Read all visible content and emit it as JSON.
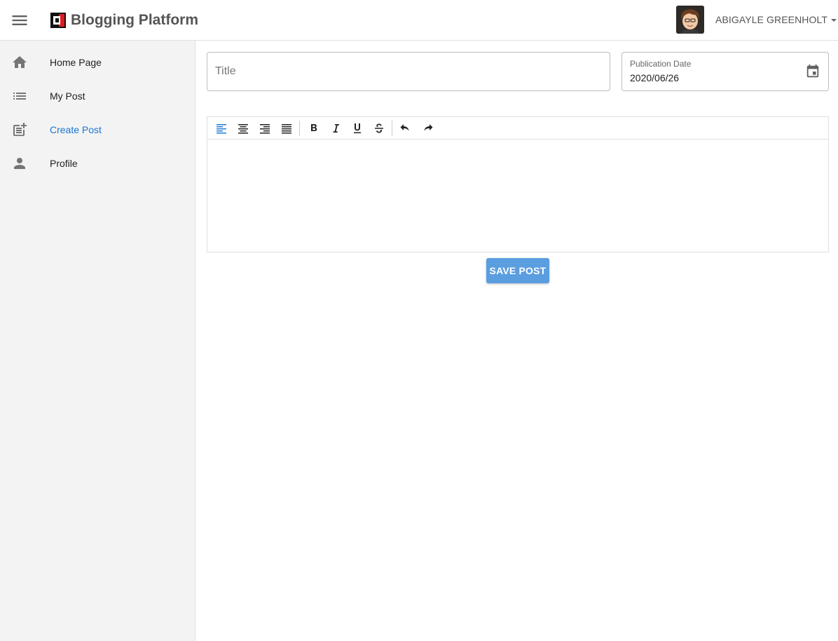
{
  "header": {
    "app_title": "Blogging Platform",
    "user_name": "ABIGAYLE GREENHOLT"
  },
  "sidebar": {
    "items": [
      {
        "label": "Home Page",
        "icon": "home-icon",
        "active": false
      },
      {
        "label": "My Post",
        "icon": "list-icon",
        "active": false
      },
      {
        "label": "Create Post",
        "icon": "post-add-icon",
        "active": true
      },
      {
        "label": "Profile",
        "icon": "person-icon",
        "active": false
      }
    ]
  },
  "form": {
    "title_placeholder": "Title",
    "title_value": "",
    "date_label": "Publication Date",
    "date_value": "2020/06/26",
    "save_label": "SAVE POST"
  },
  "editor": {
    "toolbar": [
      "align-left-icon",
      "align-center-icon",
      "align-right-icon",
      "align-justify-icon",
      "bold-icon",
      "italic-icon",
      "underline-icon",
      "strikethrough-icon",
      "undo-icon",
      "redo-icon"
    ],
    "active_tool": "align-left-icon",
    "content": ""
  },
  "colors": {
    "accent": "#1976d2",
    "button": "#5a9ee0",
    "sidebar_bg": "#f3f3f3",
    "icon": "#757575"
  }
}
